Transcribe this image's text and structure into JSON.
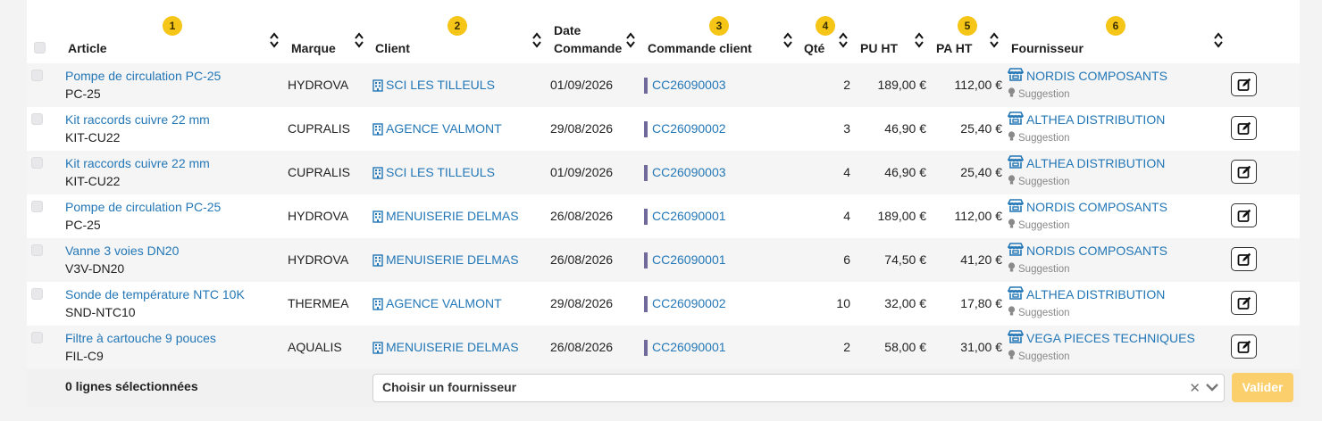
{
  "header": {
    "article": "Article",
    "marque": "Marque",
    "client": "Client",
    "date_line1": "Date",
    "date_line2": "Commande",
    "commande_client": "Commande client",
    "qte": "Qté",
    "pu_ht": "PU HT",
    "pa_ht": "PA HT",
    "fournisseur": "Fournisseur",
    "badges": [
      "1",
      "2",
      "3",
      "4",
      "5",
      "6"
    ]
  },
  "rows": [
    {
      "article": "Pompe de circulation PC-25",
      "ref": "PC-25",
      "marque": "HYDROVA",
      "client": "SCI LES TILLEULS",
      "date": "01/09/2026",
      "commande": "CC26090003",
      "qte": "2",
      "pu_ht": "189,00 €",
      "pa_ht": "112,00 €",
      "fournisseur": "NORDIS COMPOSANTS",
      "note": "Suggestion"
    },
    {
      "article": "Kit raccords cuivre 22 mm",
      "ref": "KIT-CU22",
      "marque": "CUPRALIS",
      "client": "AGENCE VALMONT",
      "date": "29/08/2026",
      "commande": "CC26090002",
      "qte": "3",
      "pu_ht": "46,90 €",
      "pa_ht": "25,40 €",
      "fournisseur": "ALTHEA DISTRIBUTION",
      "note": "Suggestion"
    },
    {
      "article": "Kit raccords cuivre 22 mm",
      "ref": "KIT-CU22",
      "marque": "CUPRALIS",
      "client": "SCI LES TILLEULS",
      "date": "01/09/2026",
      "commande": "CC26090003",
      "qte": "4",
      "pu_ht": "46,90 €",
      "pa_ht": "25,40 €",
      "fournisseur": "ALTHEA DISTRIBUTION",
      "note": "Suggestion"
    },
    {
      "article": "Pompe de circulation PC-25",
      "ref": "PC-25",
      "marque": "HYDROVA",
      "client": "MENUISERIE DELMAS",
      "date": "26/08/2026",
      "commande": "CC26090001",
      "qte": "4",
      "pu_ht": "189,00 €",
      "pa_ht": "112,00 €",
      "fournisseur": "NORDIS COMPOSANTS",
      "note": "Suggestion"
    },
    {
      "article": "Vanne 3 voies DN20",
      "ref": "V3V-DN20",
      "marque": "HYDROVA",
      "client": "MENUISERIE DELMAS",
      "date": "26/08/2026",
      "commande": "CC26090001",
      "qte": "6",
      "pu_ht": "74,50 €",
      "pa_ht": "41,20 €",
      "fournisseur": "NORDIS COMPOSANTS",
      "note": "Suggestion"
    },
    {
      "article": "Sonde de température NTC 10K",
      "ref": "SND-NTC10",
      "marque": "THERMEA",
      "client": "AGENCE VALMONT",
      "date": "29/08/2026",
      "commande": "CC26090002",
      "qte": "10",
      "pu_ht": "32,00 €",
      "pa_ht": "17,80 €",
      "fournisseur": "ALTHEA DISTRIBUTION",
      "note": "Suggestion"
    },
    {
      "article": "Filtre à cartouche 9 pouces",
      "ref": "FIL-C9",
      "marque": "AQUALIS",
      "client": "MENUISERIE DELMAS",
      "date": "26/08/2026",
      "commande": "CC26090001",
      "qte": "2",
      "pu_ht": "58,00 €",
      "pa_ht": "31,00 €",
      "fournisseur": "VEGA PIECES TECHNIQUES",
      "note": "Suggestion"
    }
  ],
  "footer": {
    "selected_count": "0 lignes sélectionnées",
    "select_value": "Choisir un fournisseur",
    "valider": "Valider"
  },
  "colors": {
    "link": "#2377b6",
    "badge": "#f5c518",
    "valider": "#fbcf6b",
    "commande_bar": "#6f6a99"
  },
  "icons": {
    "client": "building-icon",
    "fournisseur": "store-icon",
    "suggestion": "lightbulb-icon",
    "edit": "edit-icon",
    "sort": "sort-icon",
    "clear": "clear-icon",
    "dropdown": "chevron-down-icon"
  }
}
